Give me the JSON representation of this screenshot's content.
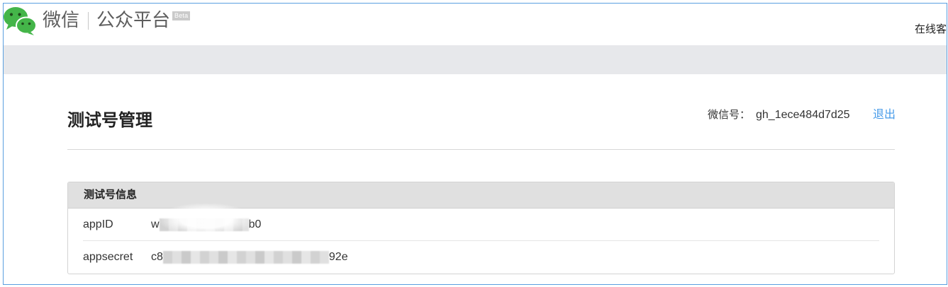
{
  "header": {
    "logo_icon": "wechat-logo-icon",
    "brand": "微信",
    "product": "公众平台",
    "badge": "Beta",
    "support_link": "在线客"
  },
  "page": {
    "title": "测试号管理",
    "account_label": "微信号：",
    "account_id": "gh_1ece484d7d25",
    "logout": "退出"
  },
  "panel": {
    "title": "测试号信息",
    "rows": [
      {
        "label": "appID",
        "value_start": "w",
        "value_end": "b0",
        "value_masked": true
      },
      {
        "label": "appsecret",
        "value_start": "c8",
        "value_end": "92e",
        "value_masked": true
      }
    ]
  },
  "colors": {
    "brand_green": "#44b549",
    "link_blue": "#459ae9",
    "nav_gray": "#e7e8eb",
    "frame_blue": "#5a9fe0"
  }
}
